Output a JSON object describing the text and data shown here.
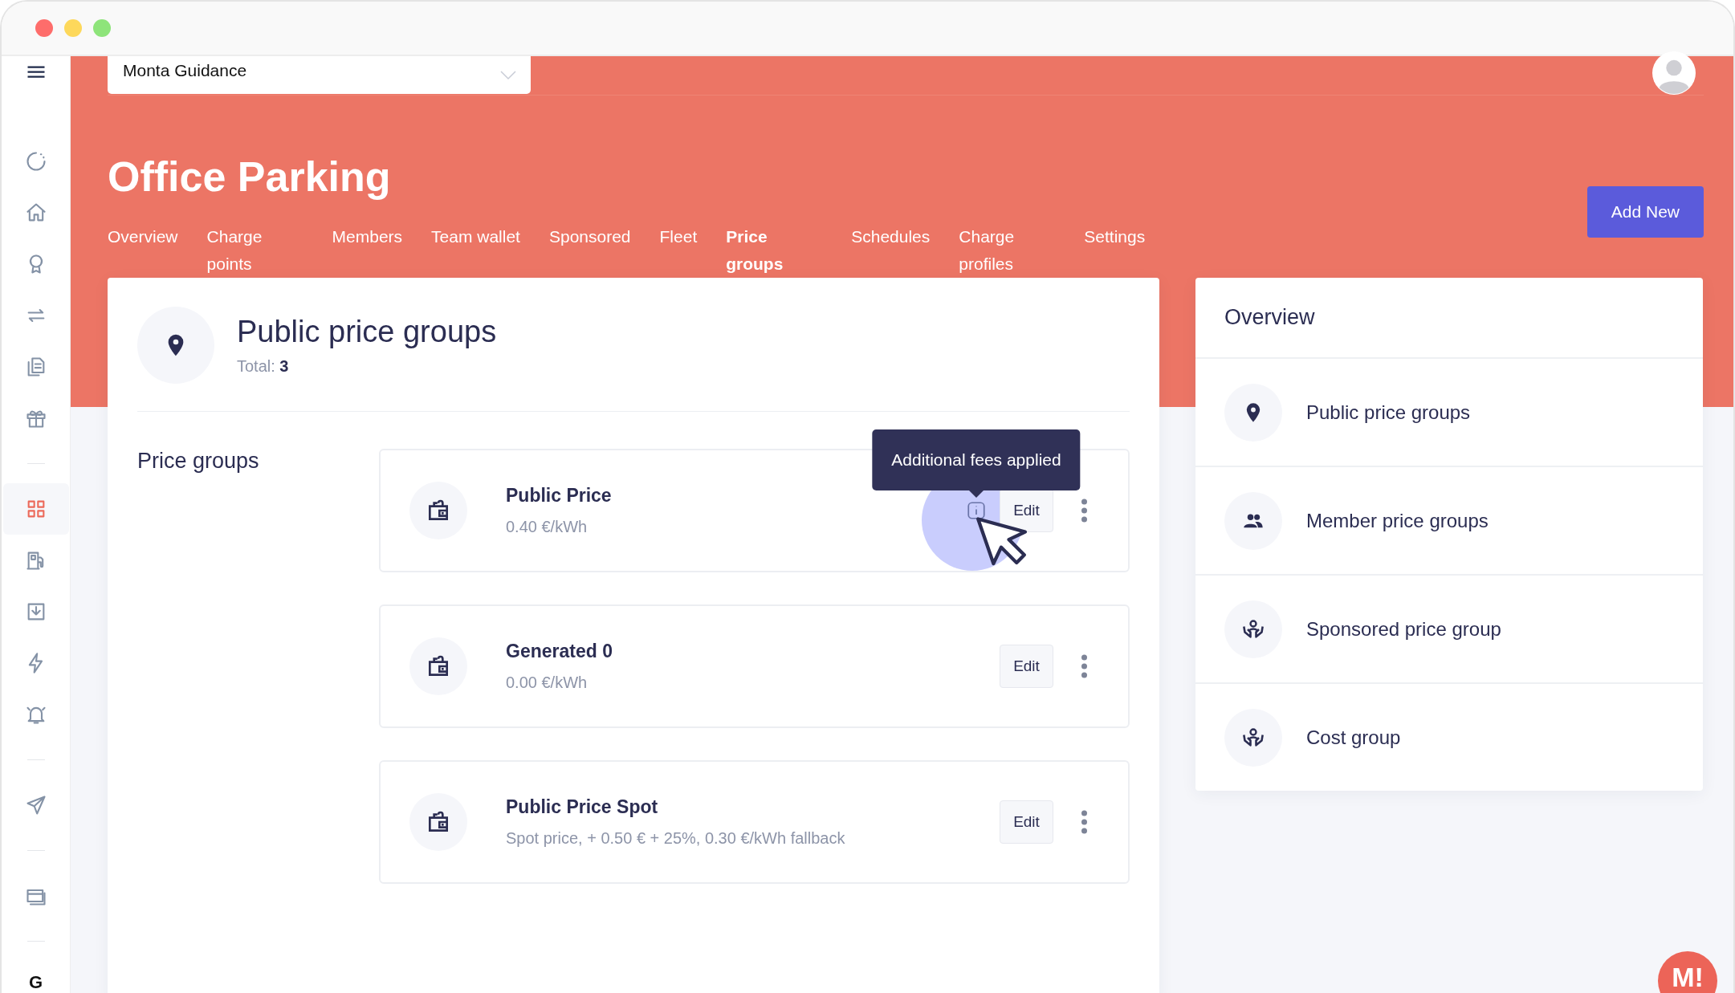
{
  "sidebar": {
    "items": [
      {
        "kind": "icon",
        "selected": false
      },
      {
        "kind": "icon",
        "selected": false
      },
      {
        "kind": "icon",
        "selected": false
      },
      {
        "kind": "icon",
        "selected": false
      },
      {
        "kind": "icon",
        "selected": false
      },
      {
        "kind": "icon",
        "selected": false
      },
      {
        "kind": "divider"
      },
      {
        "kind": "icon",
        "selected": true
      },
      {
        "kind": "icon",
        "selected": false
      },
      {
        "kind": "icon",
        "selected": false
      },
      {
        "kind": "icon",
        "selected": false
      },
      {
        "kind": "icon",
        "selected": false
      },
      {
        "kind": "divider"
      },
      {
        "kind": "icon",
        "selected": false
      },
      {
        "kind": "divider"
      },
      {
        "kind": "icon",
        "selected": false
      },
      {
        "kind": "divider"
      }
    ],
    "footer_text": "G"
  },
  "team_select": {
    "value": "Monta Guidance"
  },
  "page": {
    "title": "Office Parking",
    "add_button": "Add New"
  },
  "tabs": [
    {
      "label": "Overview",
      "selected": false
    },
    {
      "label": "Charge points",
      "selected": false
    },
    {
      "label": "Members",
      "selected": false
    },
    {
      "label": "Team wallet",
      "selected": false
    },
    {
      "label": "Sponsored",
      "selected": false
    },
    {
      "label": "Fleet",
      "selected": false
    },
    {
      "label": "Price groups",
      "selected": true
    },
    {
      "label": "Schedules",
      "selected": false
    },
    {
      "label": "Charge profiles",
      "selected": false
    },
    {
      "label": "Settings",
      "selected": false
    }
  ],
  "main_card": {
    "title": "Public price groups",
    "total": "Total: **3**",
    "section_label": "Price groups",
    "price_groups": [
      {
        "name": "Public Price",
        "price": "0.40 €/kWh",
        "edit": "Edit",
        "tooltip": "Additional fees applied"
      },
      {
        "name": "Generated 0",
        "price": "0.00 €/kWh",
        "edit": "Edit"
      },
      {
        "name": "Public Price Spot",
        "price": "Spot price, + 0.50 € + 25%, 0.30 €/kWh fallback",
        "edit": "Edit"
      }
    ]
  },
  "overview": {
    "title": "Overview",
    "items": [
      {
        "label": "Public price groups",
        "kind": "pin"
      },
      {
        "label": "Member price groups",
        "kind": "people"
      },
      {
        "label": "Sponsored price group",
        "kind": "hands"
      },
      {
        "label": "Cost group",
        "kind": "hands"
      }
    ]
  },
  "chat_button": {
    "label": "M!"
  }
}
